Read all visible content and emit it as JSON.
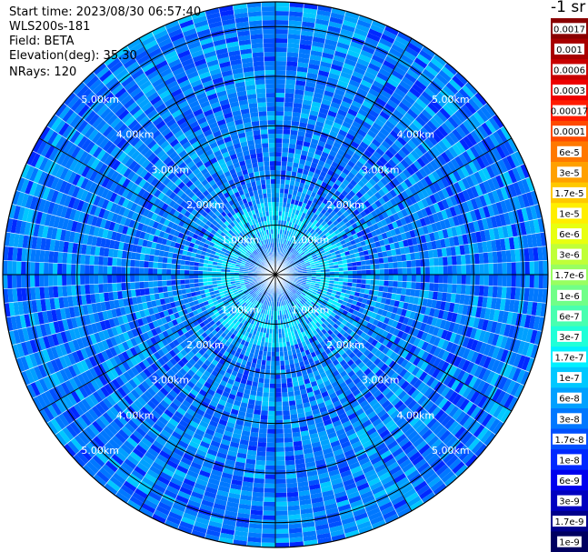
{
  "info": {
    "start_time": "Start time: 2023/08/30 06:57:40",
    "instrument": "WLS200s-181",
    "field": "Field: BETA",
    "elevation": "Elevation(deg): 35.30",
    "nrays": "NRays: 120"
  },
  "colorbar": {
    "unit": "-1 sr",
    "entries": [
      {
        "label": "0.0017",
        "color": "#8a0000"
      },
      {
        "label": "0.001",
        "color": "#a80000"
      },
      {
        "label": "0.0006",
        "color": "#c80000"
      },
      {
        "label": "0.0003",
        "color": "#ee0000"
      },
      {
        "label": "0.00017",
        "color": "#ff1c00"
      },
      {
        "label": "0.0001",
        "color": "#ff4a00"
      },
      {
        "label": "6e-5",
        "color": "#ff7800"
      },
      {
        "label": "3e-5",
        "color": "#ffa000"
      },
      {
        "label": "1.7e-5",
        "color": "#ffc800"
      },
      {
        "label": "1e-5",
        "color": "#ffee00"
      },
      {
        "label": "6e-6",
        "color": "#e8ff10"
      },
      {
        "label": "3e-6",
        "color": "#c0ff38"
      },
      {
        "label": "1.7e-6",
        "color": "#98ff60"
      },
      {
        "label": "1e-6",
        "color": "#70ff88"
      },
      {
        "label": "6e-7",
        "color": "#48ffb0"
      },
      {
        "label": "3e-7",
        "color": "#20ffd8"
      },
      {
        "label": "1.7e-7",
        "color": "#00f0ff"
      },
      {
        "label": "1e-7",
        "color": "#00c8ff"
      },
      {
        "label": "6e-8",
        "color": "#00a0ff"
      },
      {
        "label": "3e-8",
        "color": "#0078ff"
      },
      {
        "label": "1.7e-8",
        "color": "#0050ff"
      },
      {
        "label": "1e-8",
        "color": "#0028ff"
      },
      {
        "label": "6e-9",
        "color": "#0000ee"
      },
      {
        "label": "3e-9",
        "color": "#0000c0"
      },
      {
        "label": "1.7e-9",
        "color": "#00008c"
      },
      {
        "label": "1e-9",
        "color": "#000060"
      }
    ]
  },
  "chart_data": {
    "type": "heatmap",
    "projection": "polar PPI",
    "range_rings_km": [
      1,
      2,
      3,
      4,
      5
    ],
    "ring_labels": [
      "1.00km",
      "2.00km",
      "3.00km",
      "4.00km",
      "5.00km"
    ],
    "max_range_km": 5.5,
    "azimuth_lines_deg": [
      0,
      30,
      60,
      90,
      120,
      150,
      180,
      210,
      240,
      270,
      300,
      330
    ],
    "label_azimuths_deg": [
      45,
      135,
      225,
      315
    ],
    "field": "BETA",
    "dominant_values_by_range_km": [
      {
        "range_km": 0.5,
        "value": "3e-8"
      },
      {
        "range_km": 1.0,
        "value": "1.7e-7"
      },
      {
        "range_km": 1.5,
        "value": "6e-8"
      },
      {
        "range_km": 2.5,
        "value": "1.7e-8"
      },
      {
        "range_km": 3.5,
        "value": "1.7e-8"
      },
      {
        "range_km": 5.0,
        "value": "1.7e-8"
      }
    ]
  }
}
